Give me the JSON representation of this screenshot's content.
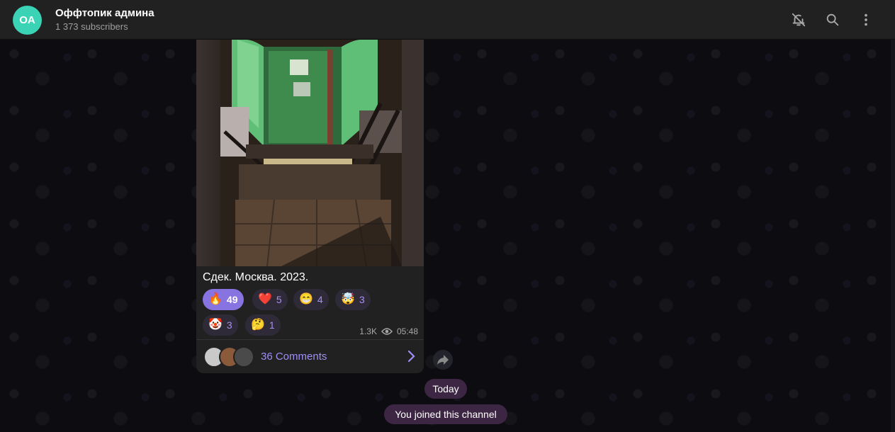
{
  "header": {
    "avatar_initials": "OA",
    "channel_name": "Оффтопик админа",
    "subscribers": "1 373 subscribers",
    "icons": [
      "mute-bell-icon",
      "search-icon",
      "more-vertical-icon"
    ]
  },
  "post": {
    "image": "photo-green-door-stairs",
    "caption": "Сдек. Москва. 2023.",
    "reactions": [
      {
        "emoji": "🔥",
        "count": "49",
        "active": true
      },
      {
        "emoji": "❤️",
        "count": "5",
        "active": false
      },
      {
        "emoji": "😁",
        "count": "4",
        "active": false
      },
      {
        "emoji": "🤯",
        "count": "3",
        "active": false
      },
      {
        "emoji": "🤡",
        "count": "3",
        "active": false
      },
      {
        "emoji": "🤔",
        "count": "1",
        "active": false
      }
    ],
    "views": "1.3K",
    "time": "05:48",
    "comments_label": "36 Comments"
  },
  "date_separator": "Today",
  "service_message": "You joined this channel",
  "colors": {
    "accent": "#8774e1",
    "avatar_bg": "#3ad3b6",
    "header_bg": "#212121",
    "pill_bg": "#3d2643"
  }
}
